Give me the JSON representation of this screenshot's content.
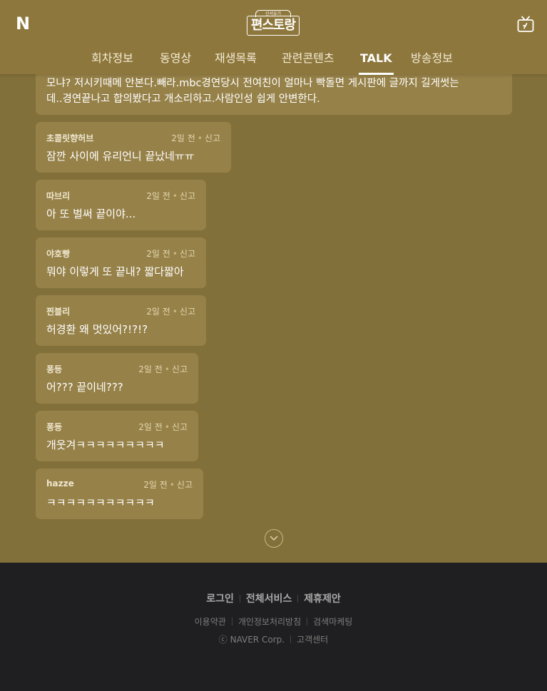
{
  "header": {
    "naver_logo": "N",
    "show_logo_sub": "신서유기",
    "show_logo_main": "편스토랑",
    "tv_icon": "tv-icon"
  },
  "nav": {
    "items": [
      "회차정보",
      "동영상",
      "재생목록",
      "관련콘텐츠",
      "TALK",
      "방송정보"
    ],
    "active": "TALK"
  },
  "comments": [
    {
      "text_line1": "모냐? 저시키때메 안본다.빼라.mbc경연당시 전여친이 얼마나 빡돌면 게시판에 글까지 길게썻는",
      "text_line2": "데..경연끝나고 합의봤다고 개소리하고.사람인성 쉽게 안변한다."
    },
    {
      "author": "초콜릿향허브",
      "time": "2일 전",
      "report": "신고",
      "text": "잠깐 사이에 유리언니 끝났네ㅠㅠ"
    },
    {
      "author": "따브리",
      "time": "2일 전",
      "report": "신고",
      "text": "아 또 벌써 끝이야..."
    },
    {
      "author": "야호빵",
      "time": "2일 전",
      "report": "신고",
      "text": "뭐야 이렇게 또 끝내? 짧다짧아"
    },
    {
      "author": "찐블리",
      "time": "2일 전",
      "report": "신고",
      "text": "허경환 왜 멋있어?!?!?"
    },
    {
      "author": "퐁등",
      "time": "2일 전",
      "report": "신고",
      "text": "어??? 끝이네???"
    },
    {
      "author": "퐁등",
      "time": "2일 전",
      "report": "신고",
      "text": "개웃겨ㅋㅋㅋㅋㅋㅋㅋㅋㅋ"
    },
    {
      "author": "hazze",
      "time": "2일 전",
      "report": "신고",
      "text": "ㅋㅋㅋㅋㅋㅋㅋㅋㅋㅋㅋ"
    }
  ],
  "more_button_icon": "chevron-down-icon",
  "footer": {
    "links_primary": [
      "로그인",
      "전체서비스",
      "제휴제안"
    ],
    "links_secondary": [
      "이용약관",
      "개인정보처리방침",
      "검색마케팅"
    ],
    "copyright": "ⓒ NAVER Corp.",
    "help": "고객센터"
  },
  "colors": {
    "header_bg": "#8e773c",
    "page_bg": "#82703a",
    "bubble_bg": "#968148",
    "footer_bg": "#1f1f21"
  }
}
